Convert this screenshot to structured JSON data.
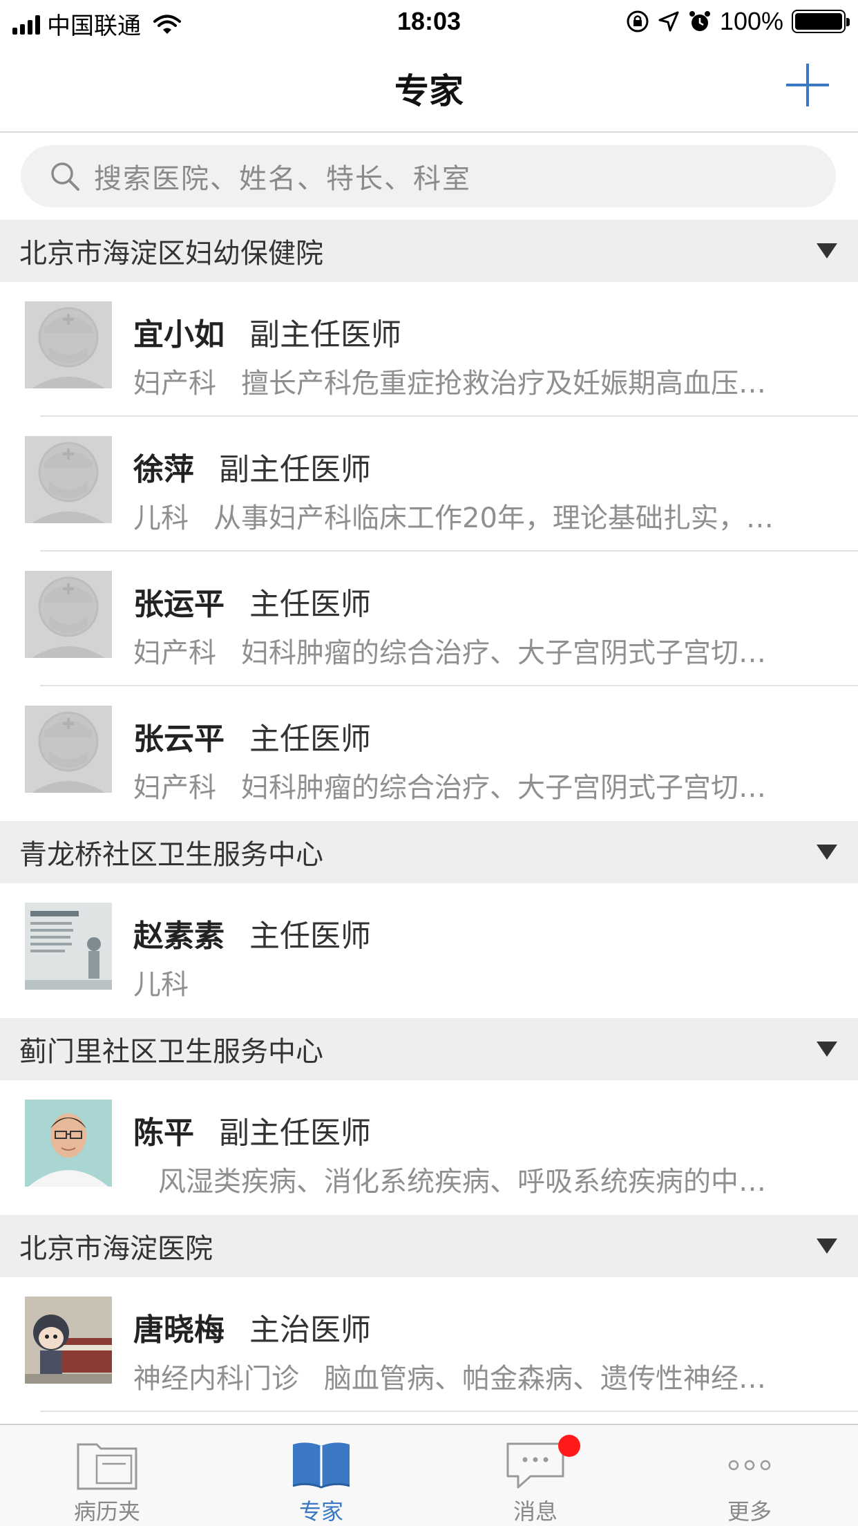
{
  "status_bar": {
    "carrier": "中国联通",
    "time": "18:03",
    "battery": "100%"
  },
  "nav": {
    "title": "专家",
    "add_icon": "plus-icon"
  },
  "search": {
    "placeholder": "搜索医院、姓名、特长、科室"
  },
  "sections": [
    {
      "hospital": "北京市海淀区妇幼保健院",
      "doctors": [
        {
          "name": "宜小如",
          "title": "副主任医师",
          "dept": "妇产科",
          "specialty": "擅长产科危重症抢救治疗及妊娠期高血压…"
        },
        {
          "name": "徐萍",
          "title": "副主任医师",
          "dept": "儿科",
          "specialty": "从事妇产科临床工作20年，理论基础扎实，…"
        },
        {
          "name": "张运平",
          "title": "主任医师",
          "dept": "妇产科",
          "specialty": "妇科肿瘤的综合治疗、大子宫阴式子宫切…"
        },
        {
          "name": "张云平",
          "title": "主任医师",
          "dept": "妇产科",
          "specialty": "妇科肿瘤的综合治疗、大子宫阴式子宫切…"
        }
      ]
    },
    {
      "hospital": "青龙桥社区卫生服务中心",
      "doctors": [
        {
          "name": "赵素素",
          "title": "主任医师",
          "dept": "儿科",
          "specialty": ""
        }
      ]
    },
    {
      "hospital": "蓟门里社区卫生服务中心",
      "doctors": [
        {
          "name": "陈平",
          "title": "副主任医师",
          "dept": "",
          "specialty": "风湿类疾病、消化系统疾病、呼吸系统疾病的中…"
        }
      ]
    },
    {
      "hospital": "北京市海淀医院",
      "doctors": [
        {
          "name": "唐晓梅",
          "title": "主治医师",
          "dept": "神经内科门诊",
          "specialty": "脑血管病、帕金森病、遗传性神经…"
        }
      ]
    }
  ],
  "tabs": [
    {
      "label": "病历夹",
      "icon": "folder-icon",
      "active": false
    },
    {
      "label": "专家",
      "icon": "book-icon",
      "active": true
    },
    {
      "label": "消息",
      "icon": "chat-icon",
      "active": false,
      "badge": true
    },
    {
      "label": "更多",
      "icon": "more-icon",
      "active": false
    }
  ],
  "colors": {
    "accent": "#3a78c3",
    "badge": "#ff1a1a",
    "section_bg": "#eeeeee"
  }
}
